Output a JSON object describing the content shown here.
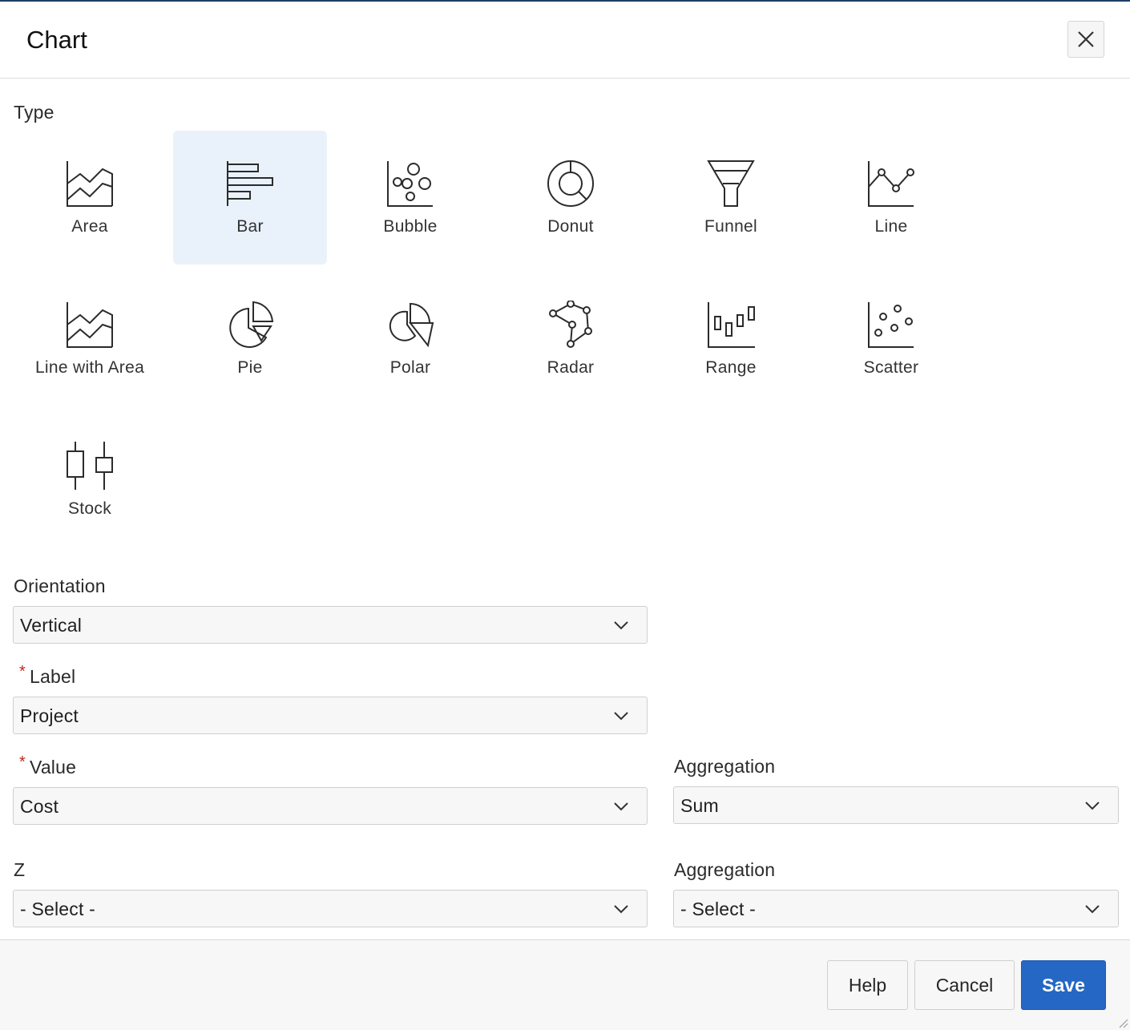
{
  "dialog": {
    "title": "Chart",
    "close_icon": "close-icon"
  },
  "type_section": {
    "label": "Type",
    "selected": "Bar",
    "types": [
      {
        "label": "Area",
        "icon": "area-chart-icon"
      },
      {
        "label": "Bar",
        "icon": "bar-chart-icon"
      },
      {
        "label": "Bubble",
        "icon": "bubble-chart-icon"
      },
      {
        "label": "Donut",
        "icon": "donut-chart-icon"
      },
      {
        "label": "Funnel",
        "icon": "funnel-chart-icon"
      },
      {
        "label": "Line",
        "icon": "line-chart-icon"
      },
      {
        "label": "Line with Area",
        "icon": "line-with-area-chart-icon"
      },
      {
        "label": "Pie",
        "icon": "pie-chart-icon"
      },
      {
        "label": "Polar",
        "icon": "polar-chart-icon"
      },
      {
        "label": "Radar",
        "icon": "radar-chart-icon"
      },
      {
        "label": "Range",
        "icon": "range-chart-icon"
      },
      {
        "label": "Scatter",
        "icon": "scatter-chart-icon"
      },
      {
        "label": "Stock",
        "icon": "stock-chart-icon"
      }
    ]
  },
  "fields": {
    "orientation": {
      "label": "Orientation",
      "value": "Vertical"
    },
    "label": {
      "label": "Label",
      "value": "Project",
      "required_mark": "*"
    },
    "value": {
      "label": "Value",
      "value": "Cost",
      "required_mark": "*"
    },
    "value_aggregation": {
      "label": "Aggregation",
      "value": "Sum"
    },
    "z": {
      "label": "Z",
      "value": "- Select -"
    },
    "z_aggregation": {
      "label": "Aggregation",
      "value": "- Select -"
    }
  },
  "footer": {
    "help_label": "Help",
    "cancel_label": "Cancel",
    "save_label": "Save"
  },
  "colors": {
    "primary": "#2567c4",
    "selected_tile": "#e9f1fa",
    "required": "#c0261a"
  }
}
